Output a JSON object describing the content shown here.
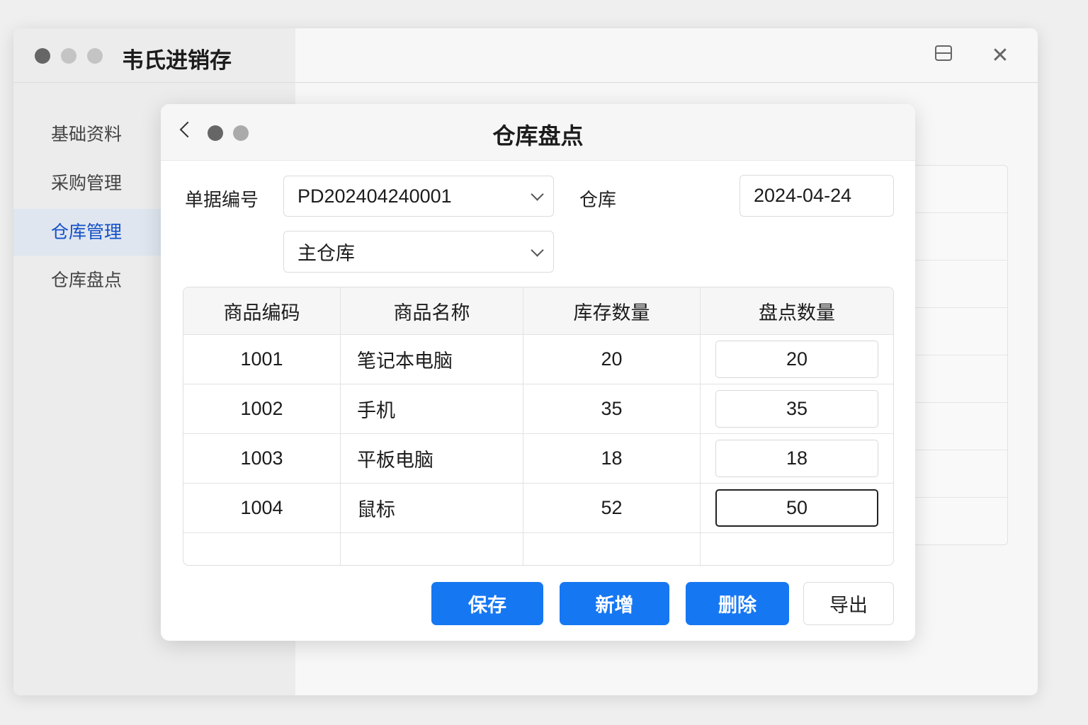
{
  "app": {
    "title": "韦氏进销存"
  },
  "sidebar": {
    "items": [
      {
        "label": "基础资料"
      },
      {
        "label": "采购管理"
      },
      {
        "label": "仓库管理"
      },
      {
        "label": "仓库盘点"
      }
    ]
  },
  "dialog": {
    "title": "仓库盘点",
    "doc_no_label": "单据编号",
    "doc_no": "PD202404240001",
    "warehouse_label": "仓库",
    "warehouse": "主仓库",
    "date": "2024-04-24",
    "columns": [
      "商品编码",
      "商品名称",
      "库存数量",
      "盘点数量"
    ],
    "rows": [
      {
        "code": "1001",
        "name": "笔记本电脑",
        "stock": "20",
        "count": "20"
      },
      {
        "code": "1002",
        "name": "手机",
        "stock": "35",
        "count": "35"
      },
      {
        "code": "1003",
        "name": "平板电脑",
        "stock": "18",
        "count": "18"
      },
      {
        "code": "1004",
        "name": "鼠标",
        "stock": "52",
        "count": "50"
      }
    ],
    "buttons": {
      "save": "保存",
      "add": "新增",
      "delete": "删除",
      "export": "导出"
    }
  }
}
